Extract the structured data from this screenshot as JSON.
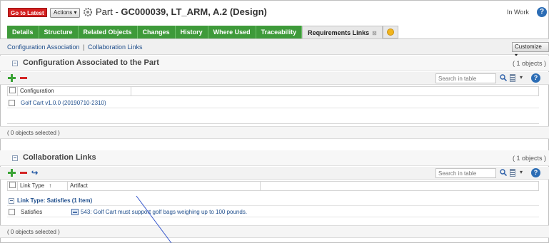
{
  "header": {
    "latest_button": "Go to Latest",
    "actions_button": "Actions",
    "part_prefix": "Part - ",
    "part_title": "GC000039, LT_ARM, A.2 (Design)",
    "state": "In Work",
    "help_glyph": "?"
  },
  "tabs": [
    {
      "label": "Details"
    },
    {
      "label": "Structure"
    },
    {
      "label": "Related Objects"
    },
    {
      "label": "Changes"
    },
    {
      "label": "History"
    },
    {
      "label": "Where Used"
    },
    {
      "label": "Traceability"
    },
    {
      "label": "Requirements Links"
    }
  ],
  "subnav": {
    "link1": "Configuration Association",
    "separator": "|",
    "link2": "Collaboration Links",
    "customize": "Customize"
  },
  "config_section": {
    "title": "Configuration Associated to the Part",
    "count": "( 1 objects )",
    "search_placeholder": "Search in table",
    "column": "Configuration",
    "row": "Golf Cart v1.0.0 (20190710-2310)",
    "footer": "( 0 objects selected )"
  },
  "collab_section": {
    "title": "Collaboration Links",
    "count": "( 1 objects )",
    "search_placeholder": "Search in table",
    "col_link_type": "Link Type",
    "sort_glyph": "↑",
    "col_artifact": "Artifact",
    "group_label": "Link Type: Satisfies (1 Item)",
    "row_type": "Satisfies",
    "row_artifact": "543: Golf Cart must support golf bags weighing up to 100 pounds.",
    "footer": "( 0 objects selected )"
  },
  "icons": {
    "add": "plus-icon",
    "remove": "minus-icon",
    "link": "link-icon",
    "find": "magnifier-icon",
    "columns": "columns-icon",
    "help": "help-icon"
  },
  "colors": {
    "tab_green": "#3e9a3a",
    "latest_red": "#d42020",
    "link_blue": "#1f4e8c",
    "annotation_line": "#3355cc"
  }
}
